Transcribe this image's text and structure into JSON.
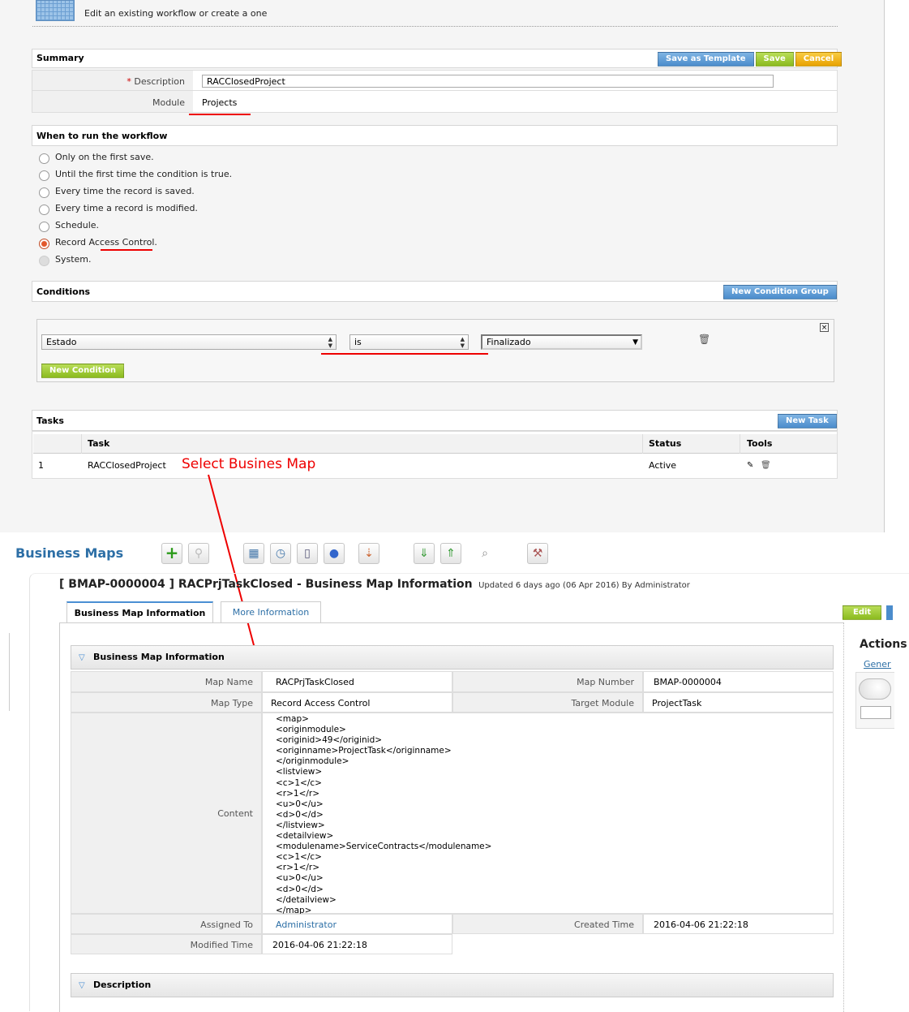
{
  "header": {
    "subtitle": "Edit an existing workflow or create a one"
  },
  "summary": {
    "title": "Summary",
    "save_as_template": "Save as Template",
    "save": "Save",
    "cancel": "Cancel",
    "description_label": "Description",
    "required_mark": "*",
    "description_value": "RACClosedProject",
    "module_label": "Module",
    "module_value": "Projects"
  },
  "when": {
    "title": "When to run the workflow",
    "options": [
      {
        "label": "Only on the first save.",
        "state": "off"
      },
      {
        "label": "Until the first time the condition is true.",
        "state": "off"
      },
      {
        "label": "Every time the record is saved.",
        "state": "off"
      },
      {
        "label": "Every time a record is modified.",
        "state": "off"
      },
      {
        "label": "Schedule.",
        "state": "off"
      },
      {
        "label": "Record Access Control.",
        "state": "selected"
      },
      {
        "label": "System.",
        "state": "disabled"
      }
    ]
  },
  "conditions": {
    "title": "Conditions",
    "new_group": "New Condition Group",
    "field": "Estado",
    "operator": "is",
    "value": "Finalizado",
    "new_condition": "New Condition"
  },
  "tasks": {
    "title": "Tasks",
    "new_task": "New Task",
    "columns": [
      "",
      "Task",
      "Status",
      "Tools"
    ],
    "rows": [
      {
        "num": "1",
        "task": "RACClosedProject",
        "status": "Active"
      }
    ]
  },
  "annotation": {
    "text": "Select Busines Map",
    "color": "#e00000"
  },
  "bmap": {
    "module_title": "Business Maps",
    "record_title": "[ BMAP-0000004 ] RACPrjTaskClosed - Business Map Information",
    "updated": "Updated 6 days ago (06 Apr 2016) By Administrator",
    "tab_info": "Business Map Information",
    "tab_more": "More Information",
    "edit": "Edit",
    "actions": "Actions",
    "general": "General",
    "block_title": "Business Map Information",
    "map_name_label": "Map Name",
    "map_name": "RACPrjTaskClosed",
    "map_number_label": "Map Number",
    "map_number": "BMAP-0000004",
    "map_type_label": "Map Type",
    "map_type": "Record Access Control",
    "target_module_label": "Target Module",
    "target_module": "ProjectTask",
    "content_label": "Content",
    "content_lines": [
      "<map>",
      "<originmodule>",
      "<originid>49</originid>",
      "<originname>ProjectTask</originname>",
      "</originmodule>",
      "<listview>",
      "<c>1</c>",
      "<r>1</r>",
      "<u>0</u>",
      "<d>0</d>",
      "</listview>",
      "<detailview>",
      "<modulename>ServiceContracts</modulename>",
      "<c>1</c>",
      "<r>1</r>",
      "<u>0</u>",
      "<d>0</d>",
      "</detailview>",
      "</map>"
    ],
    "assigned_to_label": "Assigned To",
    "assigned_to": "Administrator",
    "created_time_label": "Created Time",
    "created_time": "2016-04-06 21:22:18",
    "modified_time_label": "Modified Time",
    "modified_time": "2016-04-06 21:22:18",
    "description_block": "Description"
  }
}
